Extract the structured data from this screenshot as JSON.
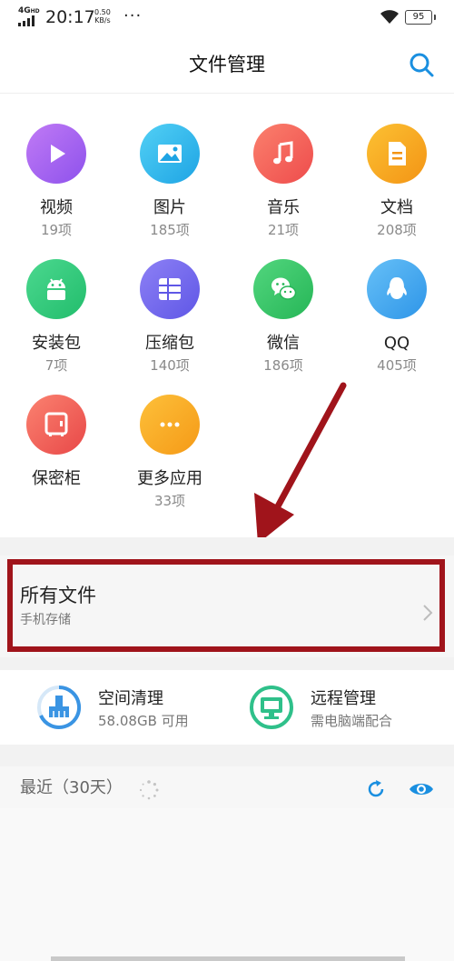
{
  "status_bar": {
    "network": "4G",
    "network_sup": "HD",
    "time": "20:17",
    "speed_value": "0.50",
    "speed_unit": "KB/s",
    "dots": "···",
    "battery": "95"
  },
  "header": {
    "title": "文件管理",
    "search_icon": "search-icon"
  },
  "categories": [
    {
      "label": "视频",
      "count": "19项",
      "color": "#a063f0",
      "icon": "play-icon"
    },
    {
      "label": "图片",
      "count": "185项",
      "color": "#2bb8ea",
      "icon": "image-icon"
    },
    {
      "label": "音乐",
      "count": "21项",
      "color": "#f2605a",
      "icon": "music-note-icon"
    },
    {
      "label": "文档",
      "count": "208项",
      "color": "#f6a31c",
      "icon": "document-icon"
    },
    {
      "label": "安装包",
      "count": "7项",
      "color": "#30c87c",
      "icon": "android-icon"
    },
    {
      "label": "压缩包",
      "count": "140项",
      "color": "#7069ee",
      "icon": "archive-icon"
    },
    {
      "label": "微信",
      "count": "186项",
      "color": "#3ac469",
      "icon": "wechat-icon"
    },
    {
      "label": "QQ",
      "count": "405项",
      "color": "#3ba2ec",
      "icon": "qq-penguin-icon"
    },
    {
      "label": "保密柜",
      "count": "",
      "color": "#f06257",
      "icon": "safe-icon"
    },
    {
      "label": "更多应用",
      "count": "33项",
      "color": "#f8a61f",
      "icon": "more-dots-icon"
    }
  ],
  "all_files": {
    "title": "所有文件",
    "subtitle": "手机存储"
  },
  "tools": [
    {
      "name": "空间清理",
      "sub": "58.08GB 可用",
      "icon": "broom-icon"
    },
    {
      "name": "远程管理",
      "sub": "需电脑端配合",
      "icon": "monitor-icon"
    }
  ],
  "recent": {
    "title": "最近（30天）"
  },
  "colors": {
    "accent": "#1a8fe0",
    "annotation": "#a0141b"
  }
}
